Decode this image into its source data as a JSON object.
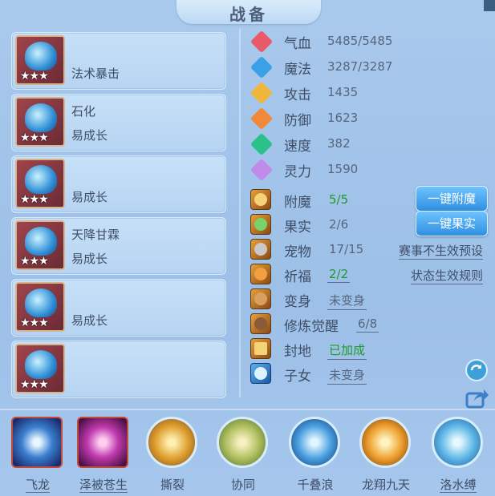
{
  "title": "战备",
  "slots": [
    {
      "line1": "",
      "line2": "法术暴击",
      "stars": "★★★"
    },
    {
      "line1": "石化",
      "line2": "易成长",
      "stars": "★★★"
    },
    {
      "line1": "",
      "line2": "易成长",
      "stars": "★★★"
    },
    {
      "line1": "天降甘霖",
      "line2": "易成长",
      "stars": "★★★"
    },
    {
      "line1": "",
      "line2": "易成长",
      "stars": "★★★"
    },
    {
      "line1": "",
      "line2": "",
      "stars": "★★★"
    }
  ],
  "stats": [
    {
      "label": "气血",
      "value": "5485/5485",
      "icon": "heart-icon",
      "color": "#e85a6a"
    },
    {
      "label": "魔法",
      "value": "3287/3287",
      "icon": "mana-icon",
      "color": "#3aa0e8"
    },
    {
      "label": "攻击",
      "value": "1435",
      "icon": "sword-icon",
      "color": "#f0b63a"
    },
    {
      "label": "防御",
      "value": "1623",
      "icon": "shield-icon",
      "color": "#f0893a"
    },
    {
      "label": "速度",
      "value": "382",
      "icon": "lightning-icon",
      "color": "#2cc08a"
    },
    {
      "label": "灵力",
      "value": "1590",
      "icon": "spirit-icon",
      "color": "#c08ae8"
    }
  ],
  "rows": [
    {
      "label": "附魔",
      "value": "5/5",
      "green": true,
      "icon": "enchant-icon"
    },
    {
      "label": "果实",
      "value": "2/6",
      "green": false,
      "icon": "fruit-icon"
    },
    {
      "label": "宠物",
      "value": "17/15",
      "green": false,
      "icon": "pet-icon"
    },
    {
      "label": "祈福",
      "value": "2/2",
      "green": true,
      "icon": "blessing-icon"
    },
    {
      "label": "变身",
      "value": "未变身",
      "green": false,
      "icon": "transform-icon"
    },
    {
      "label": "修炼觉醒",
      "value": "6/8",
      "green": false,
      "icon": "cultivate-icon"
    },
    {
      "label": "封地",
      "value": "已加成",
      "green": true,
      "icon": "fief-icon"
    },
    {
      "label": "子女",
      "value": "未变身",
      "green": false,
      "icon": "child-icon"
    }
  ],
  "buttons": {
    "enchant": "一键附魔",
    "fruit": "一键果实"
  },
  "links": {
    "pet": "赛事不生效预设",
    "bless": "状态生效规则"
  },
  "skills": [
    {
      "name": "飞龙",
      "underline": true
    },
    {
      "name": "泽被苍生",
      "underline": true
    },
    {
      "name": "撕裂",
      "underline": false
    },
    {
      "name": "协同",
      "underline": false
    },
    {
      "name": "千叠浪",
      "underline": false
    },
    {
      "name": "龙翔九天",
      "underline": false
    },
    {
      "name": "洛水缚",
      "underline": true
    }
  ]
}
